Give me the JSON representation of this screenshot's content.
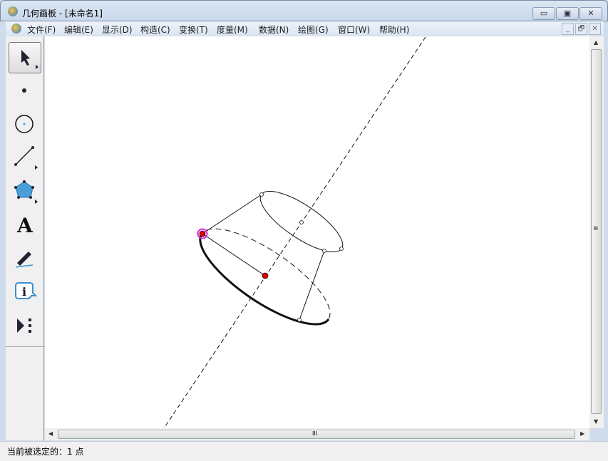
{
  "window": {
    "title": "几何画板 - [未命名1]",
    "min": "▭",
    "max": "▣",
    "close": "✕"
  },
  "menu": [
    "文件(F)",
    "编辑(E)",
    "显示(D)",
    "构造(C)",
    "变换(T)",
    "度量(M)",
    "数据(N)",
    "绘图(G)",
    "窗口(W)",
    "帮助(H)"
  ],
  "mdi": {
    "min": "_",
    "restore": "🗗",
    "close": "✕"
  },
  "tools": [
    "arrow-tool",
    "point-tool",
    "compass-tool",
    "straightedge-tool",
    "polygon-tool",
    "text-tool",
    "marker-tool",
    "information-tool",
    "custom-tool"
  ],
  "text_tool_glyph": "A",
  "info_tool_glyph": "i",
  "hscroll_grip": "III",
  "vscroll_grip": "≡",
  "status": {
    "text": "当前被选定的：1 点"
  },
  "colors": {
    "selected_point": "#e00000",
    "selection_ring": "#e020e0",
    "polygon": "#4a9fd8"
  }
}
